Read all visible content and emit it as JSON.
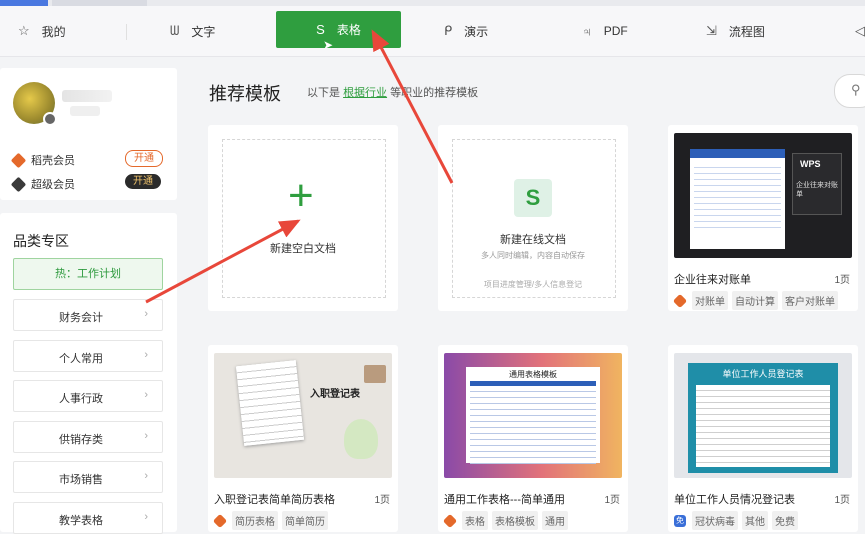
{
  "tabs": [
    {
      "label": "我的",
      "icon": "star-icon"
    },
    {
      "label": "文字",
      "icon": "w-doc-icon"
    },
    {
      "label": "表格",
      "icon": "s-sheet-icon"
    },
    {
      "label": "演示",
      "icon": "p-slide-icon"
    },
    {
      "label": "PDF",
      "icon": "pdf-icon"
    },
    {
      "label": "流程图",
      "icon": "flowchart-icon"
    }
  ],
  "user": {
    "memberships": [
      {
        "label": "稻壳会员",
        "button": "开通",
        "color": "#e4692b"
      },
      {
        "label": "超级会员",
        "button": "开通",
        "color": "#3a3a3a"
      }
    ]
  },
  "categories": {
    "title": "品类专区",
    "hot": "热：工作计划",
    "items": [
      "财务会计",
      "个人常用",
      "人事行政",
      "供销存类",
      "市场销售",
      "教学表格"
    ]
  },
  "main": {
    "title": "推荐模板",
    "subtitle_prefix": "以下是",
    "subtitle_link": "根据行业",
    "subtitle_suffix": "等职业的推荐模板"
  },
  "new_blank": {
    "label": "新建空白文档"
  },
  "new_online": {
    "label": "新建在线文档",
    "desc": "多人同时编辑，内容自动保存",
    "desc2": "项目进度管理/多人信息登记"
  },
  "templates": [
    {
      "name": "企业往来对账单",
      "pages": "1页",
      "tags": [
        "对账单",
        "自动计算",
        "客户对账单"
      ],
      "thumb_title": "企业往来对账单",
      "brand": "WPS"
    },
    {
      "name": "入职登记表简单简历表格",
      "pages": "1页",
      "tags": [
        "简历表格",
        "简单简历"
      ],
      "thumb_title": "入职登记表"
    },
    {
      "name": "通用工作表格---简单通用",
      "pages": "1页",
      "tags": [
        "表格",
        "表格模板",
        "通用"
      ],
      "thumb_title": "通用表格模板"
    },
    {
      "name": "单位工作人员情况登记表",
      "pages": "1页",
      "tags": [
        "冠状病毒",
        "其他",
        "免费"
      ],
      "thumb_title": "单位工作人员登记表",
      "free_badge": "免"
    }
  ],
  "colors": {
    "accent": "#2f9e3f",
    "arrow": "#e8473a"
  }
}
